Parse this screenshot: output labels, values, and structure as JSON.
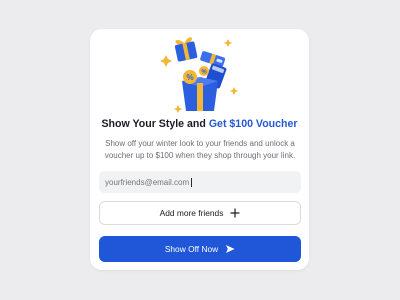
{
  "card": {
    "title_main": "Show Your Style and ",
    "title_accent": "Get $100 Voucher",
    "description": "Show off your winter look to your friends and unlock a voucher up to $100 when they shop through your link.",
    "email_placeholder": "yourfriends@email.com",
    "email_value": "",
    "add_friends_label": "Add more friends",
    "submit_label": "Show Off Now"
  },
  "icons": {
    "illustration": "gift-box-illustration",
    "add": "plus-icon",
    "submit": "send-icon"
  },
  "colors": {
    "accent": "#2457d6",
    "primary_button": "#1f57d8",
    "background": "#ececee",
    "card": "#ffffff",
    "input_background": "#f1f2f4",
    "gift_blue": "#2b5fe0",
    "gift_ribbon": "#f4b733"
  }
}
